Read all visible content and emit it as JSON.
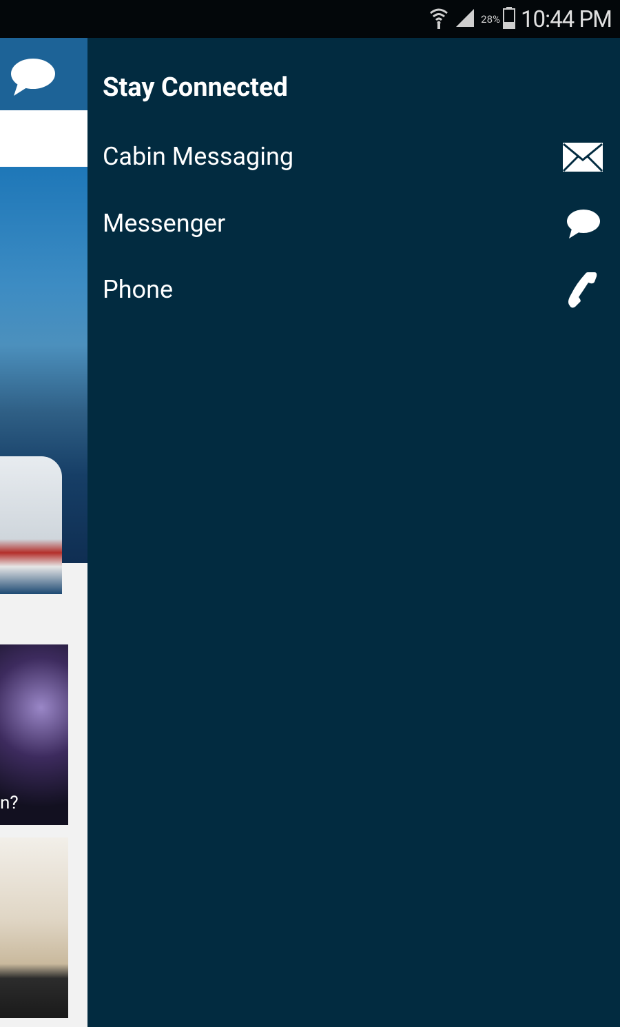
{
  "status_bar": {
    "battery_percent": "28%",
    "time": "10:44 PM",
    "icons": [
      "wifi-icon",
      "signal-icon",
      "battery-icon"
    ]
  },
  "background_app": {
    "partial_card_text": "n?"
  },
  "drawer": {
    "title": "Stay Connected",
    "items": [
      {
        "label": "Cabin Messaging",
        "icon": "envelope-icon"
      },
      {
        "label": "Messenger",
        "icon": "chat-bubble-icon"
      },
      {
        "label": "Phone",
        "icon": "phone-icon"
      }
    ]
  },
  "colors": {
    "drawer_bg": "#022b40",
    "header_blue": "#1d6397",
    "status_bar_bg": "#03070a"
  }
}
